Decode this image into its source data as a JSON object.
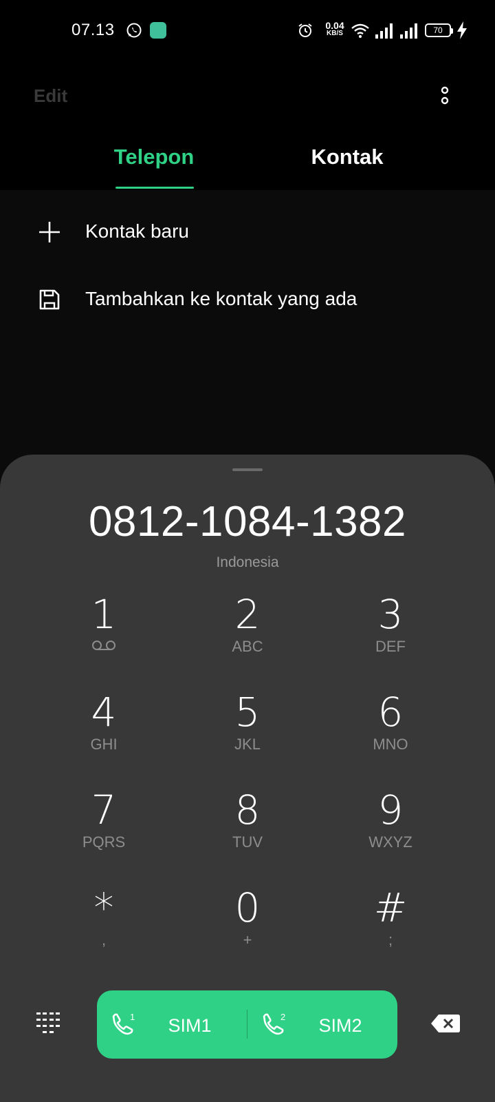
{
  "status_bar": {
    "time": "07.13",
    "net_speed_value": "0.04",
    "net_speed_unit": "KB/S",
    "battery": "70",
    "icons": [
      "whatsapp-icon",
      "app-badge-icon",
      "alarm-icon",
      "wifi-icon",
      "signal-icon",
      "signal-icon",
      "battery-icon",
      "charging-bolt-icon"
    ]
  },
  "header": {
    "edit_label": "Edit",
    "more_icon": "more-vertical-icon"
  },
  "tabs": [
    {
      "label": "Telepon",
      "active": true
    },
    {
      "label": "Kontak",
      "active": false
    }
  ],
  "actions": [
    {
      "label": "Kontak baru",
      "icon": "plus-icon"
    },
    {
      "label": "Tambahkan ke kontak yang ada",
      "icon": "save-icon"
    }
  ],
  "dialer": {
    "number": "0812-1084-1382",
    "country": "Indonesia",
    "keys": [
      {
        "digit": "1",
        "letters": ""
      },
      {
        "digit": "2",
        "letters": "ABC"
      },
      {
        "digit": "3",
        "letters": "DEF"
      },
      {
        "digit": "4",
        "letters": "GHI"
      },
      {
        "digit": "5",
        "letters": "JKL"
      },
      {
        "digit": "6",
        "letters": "MNO"
      },
      {
        "digit": "7",
        "letters": "PQRS"
      },
      {
        "digit": "8",
        "letters": "TUV"
      },
      {
        "digit": "9",
        "letters": "WXYZ"
      },
      {
        "digit": "*",
        "letters": ","
      },
      {
        "digit": "0",
        "letters": "+"
      },
      {
        "digit": "#",
        "letters": ";"
      }
    ],
    "sim1_label": "SIM1",
    "sim2_label": "SIM2",
    "sim1_index": "1",
    "sim2_index": "2",
    "accent_color": "#2ed185"
  }
}
